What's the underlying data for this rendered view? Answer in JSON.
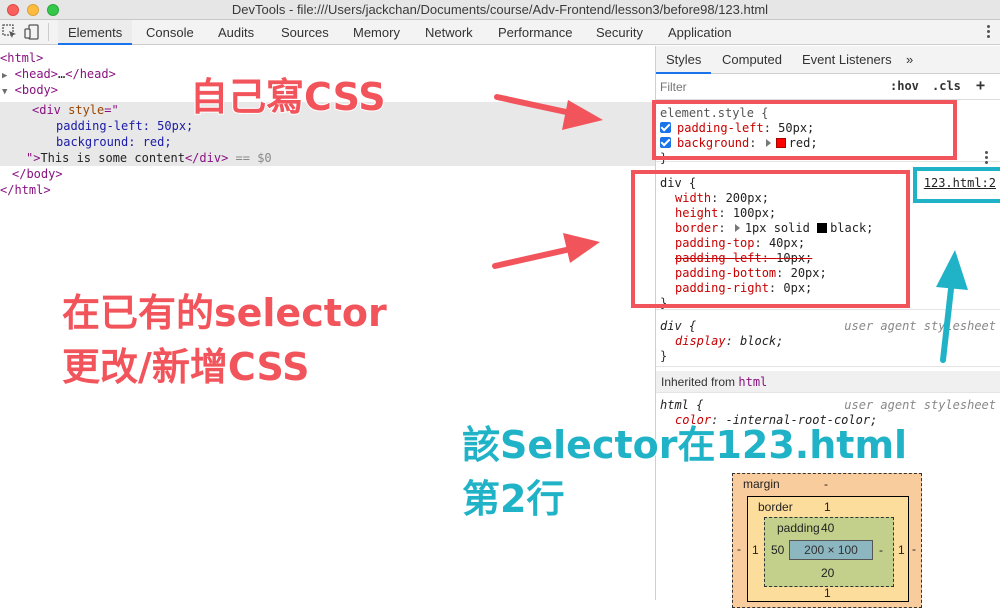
{
  "window": {
    "title": "DevTools - file:///Users/jackchan/Documents/course/Adv-Frontend/lesson3/before98/123.html"
  },
  "tabs": [
    "Elements",
    "Console",
    "Audits",
    "Sources",
    "Memory",
    "Network",
    "Performance",
    "Security",
    "Application"
  ],
  "active_tab": "Elements",
  "dom": {
    "l1": "<html>",
    "l2_tag": "<head>",
    "l2_ell": "…",
    "l2_close": "</head>",
    "l3": "<body>",
    "l4_open": "<div ",
    "l4_attr": "style",
    "l4_eq": "=\"",
    "l5": "padding-left: 50px;",
    "l6": "background: red;",
    "l7_q": "\">",
    "l7_text": "This is some content",
    "l7_close": "</div>",
    "l7_eq": " == $0",
    "l8": "</body>",
    "l9": "</html>"
  },
  "sidebar": {
    "tabs": [
      "Styles",
      "Computed",
      "Event Listeners"
    ],
    "more": "»",
    "filter_placeholder": "Filter",
    "hov": ":hov",
    "cls": ".cls",
    "plus": "+"
  },
  "element_style": {
    "selector": "element.style {",
    "p1_name": "padding-left",
    "p1_val": "50px;",
    "p2_name": "background",
    "p2_val": "red;",
    "close": "}"
  },
  "div_rule": {
    "selector": "div {",
    "source": "123.html:2",
    "width_name": "width",
    "width_val": "200px;",
    "height_name": "height",
    "height_val": "100px;",
    "border_name": "border",
    "border_val": "1px solid ",
    "border_color": "black;",
    "pt_name": "padding-top",
    "pt_val": "40px;",
    "pl_name": "padding-left",
    "pl_val": "10px;",
    "pb_name": "padding-bottom",
    "pb_val": "20px;",
    "pr_name": "padding-right",
    "pr_val": "0px;",
    "close": "}"
  },
  "ua_div": {
    "selector": "div {",
    "source": "user agent stylesheet",
    "prop": "display",
    "val": "block;",
    "close": "}"
  },
  "inherited": {
    "label": "Inherited from ",
    "element": "html"
  },
  "ua_html": {
    "selector": "html {",
    "source": "user agent stylesheet",
    "prop": "color",
    "val": "-internal-root-color;"
  },
  "box_model": {
    "margin_label": "margin",
    "margin_top": "-",
    "margin_left": "-",
    "margin_right": "-",
    "border_label": "border",
    "border_top": "1",
    "border_left": "1",
    "border_right": "1",
    "border_bottom": "1",
    "padding_label": "padding",
    "padding_top": "40",
    "padding_left": "50",
    "padding_right": "-",
    "padding_bottom": "20",
    "content": "200 × 100"
  },
  "annotations": {
    "a1": "自己寫CSS",
    "a2_line1": "在已有的selector",
    "a2_line2": "更改/新增CSS",
    "a3_line1": "該Selector在123.html",
    "a3_line2": "第2行"
  },
  "colors": {
    "annot_red": "#f2545b",
    "annot_blue": "#20b3c7",
    "swatch_red": "#ff0000",
    "swatch_black": "#000000"
  }
}
